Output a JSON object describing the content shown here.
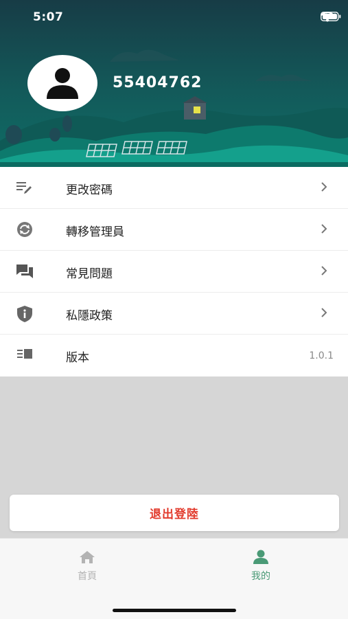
{
  "status_bar": {
    "time": "5:07"
  },
  "profile": {
    "username": "55404762"
  },
  "menu": {
    "items": [
      {
        "label": "更改密碼",
        "icon": "edit-list-icon"
      },
      {
        "label": "轉移管理員",
        "icon": "sync-icon"
      },
      {
        "label": "常見問題",
        "icon": "chat-icon"
      },
      {
        "label": "私隱政策",
        "icon": "shield-info-icon"
      },
      {
        "label": "版本",
        "icon": "version-icon",
        "value": "1.0.1"
      }
    ]
  },
  "logout": {
    "label": "退出登陸"
  },
  "tabbar": {
    "home_label": "首頁",
    "me_label": "我的",
    "active": "me"
  },
  "colors": {
    "header_top": "#163f47",
    "header_bottom": "#0f6a63",
    "accent_green": "#4a9a76",
    "logout_red": "#e23a2c",
    "tab_inactive": "#b3b3b3"
  }
}
